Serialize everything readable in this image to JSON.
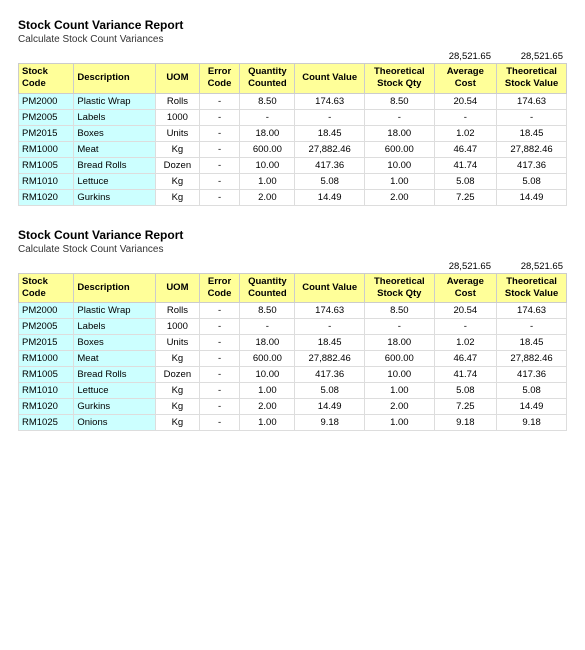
{
  "report1": {
    "title": "Stock Count Variance Report",
    "subtitle": "Calculate Stock Count Variances",
    "total_left": "28,521.65",
    "total_right": "28,521.65",
    "columns": [
      "Stock Code",
      "Description",
      "UOM",
      "Error Code",
      "Quantity Counted",
      "Count Value",
      "Theoretical Stock Qty",
      "Average Cost",
      "Theoretical Stock Value"
    ],
    "rows": [
      {
        "stock_code": "PM2000",
        "description": "Plastic Wrap",
        "uom": "Rolls",
        "error_code": "-",
        "qty_counted": "8.50",
        "count_value": "174.63",
        "theo_qty": "8.50",
        "avg_cost": "20.54",
        "theo_value": "174.63"
      },
      {
        "stock_code": "PM2005",
        "description": "Labels",
        "uom": "1000",
        "error_code": "-",
        "qty_counted": "-",
        "count_value": "-",
        "theo_qty": "-",
        "avg_cost": "-",
        "theo_value": "-"
      },
      {
        "stock_code": "PM2015",
        "description": "Boxes",
        "uom": "Units",
        "error_code": "-",
        "qty_counted": "18.00",
        "count_value": "18.45",
        "theo_qty": "18.00",
        "avg_cost": "1.02",
        "theo_value": "18.45"
      },
      {
        "stock_code": "RM1000",
        "description": "Meat",
        "uom": "Kg",
        "error_code": "-",
        "qty_counted": "600.00",
        "count_value": "27,882.46",
        "theo_qty": "600.00",
        "avg_cost": "46.47",
        "theo_value": "27,882.46"
      },
      {
        "stock_code": "RM1005",
        "description": "Bread Rolls",
        "uom": "Dozen",
        "error_code": "-",
        "qty_counted": "10.00",
        "count_value": "417.36",
        "theo_qty": "10.00",
        "avg_cost": "41.74",
        "theo_value": "417.36"
      },
      {
        "stock_code": "RM1010",
        "description": "Lettuce",
        "uom": "Kg",
        "error_code": "-",
        "qty_counted": "1.00",
        "count_value": "5.08",
        "theo_qty": "1.00",
        "avg_cost": "5.08",
        "theo_value": "5.08"
      },
      {
        "stock_code": "RM1020",
        "description": "Gurkins",
        "uom": "Kg",
        "error_code": "-",
        "qty_counted": "2.00",
        "count_value": "14.49",
        "theo_qty": "2.00",
        "avg_cost": "7.25",
        "theo_value": "14.49"
      }
    ]
  },
  "report2": {
    "title": "Stock Count Variance Report",
    "subtitle": "Calculate Stock Count Variances",
    "total_left": "28,521.65",
    "total_right": "28,521.65",
    "columns": [
      "Stock Code",
      "Description",
      "UOM",
      "Error Code",
      "Quantity Counted",
      "Count Value",
      "Theoretical Stock Qty",
      "Average Cost",
      "Theoretical Stock Value"
    ],
    "rows": [
      {
        "stock_code": "PM2000",
        "description": "Plastic Wrap",
        "uom": "Rolls",
        "error_code": "-",
        "qty_counted": "8.50",
        "count_value": "174.63",
        "theo_qty": "8.50",
        "avg_cost": "20.54",
        "theo_value": "174.63"
      },
      {
        "stock_code": "PM2005",
        "description": "Labels",
        "uom": "1000",
        "error_code": "-",
        "qty_counted": "-",
        "count_value": "-",
        "theo_qty": "-",
        "avg_cost": "-",
        "theo_value": "-"
      },
      {
        "stock_code": "PM2015",
        "description": "Boxes",
        "uom": "Units",
        "error_code": "-",
        "qty_counted": "18.00",
        "count_value": "18.45",
        "theo_qty": "18.00",
        "avg_cost": "1.02",
        "theo_value": "18.45"
      },
      {
        "stock_code": "RM1000",
        "description": "Meat",
        "uom": "Kg",
        "error_code": "-",
        "qty_counted": "600.00",
        "count_value": "27,882.46",
        "theo_qty": "600.00",
        "avg_cost": "46.47",
        "theo_value": "27,882.46"
      },
      {
        "stock_code": "RM1005",
        "description": "Bread Rolls",
        "uom": "Dozen",
        "error_code": "-",
        "qty_counted": "10.00",
        "count_value": "417.36",
        "theo_qty": "10.00",
        "avg_cost": "41.74",
        "theo_value": "417.36"
      },
      {
        "stock_code": "RM1010",
        "description": "Lettuce",
        "uom": "Kg",
        "error_code": "-",
        "qty_counted": "1.00",
        "count_value": "5.08",
        "theo_qty": "1.00",
        "avg_cost": "5.08",
        "theo_value": "5.08"
      },
      {
        "stock_code": "RM1020",
        "description": "Gurkins",
        "uom": "Kg",
        "error_code": "-",
        "qty_counted": "2.00",
        "count_value": "14.49",
        "theo_qty": "2.00",
        "avg_cost": "7.25",
        "theo_value": "14.49"
      },
      {
        "stock_code": "RM1025",
        "description": "Onions",
        "uom": "Kg",
        "error_code": "-",
        "qty_counted": "1.00",
        "count_value": "9.18",
        "theo_qty": "1.00",
        "avg_cost": "9.18",
        "theo_value": "9.18"
      }
    ]
  }
}
